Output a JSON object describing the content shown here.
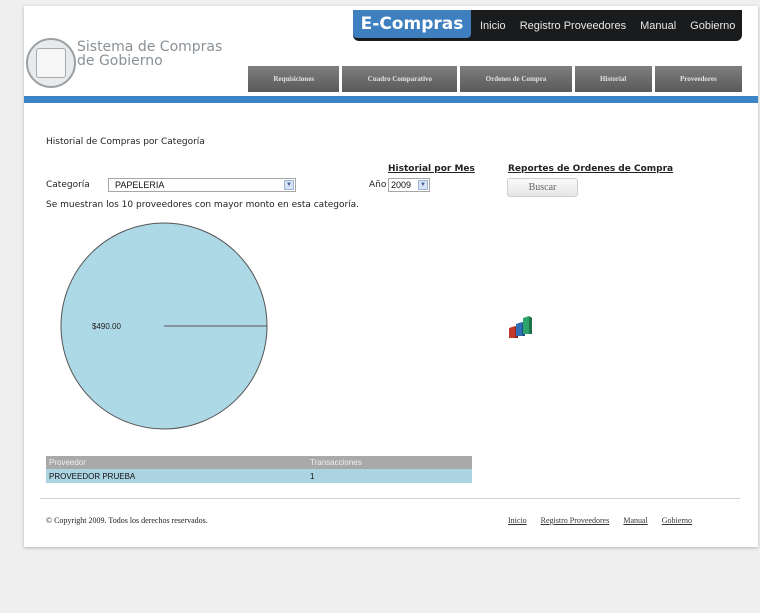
{
  "header": {
    "brand_line1": "Sistema de Compras",
    "brand_line2": "de Gobierno",
    "app_name": "E-Compras",
    "top_links": [
      "Inicio",
      "Registro Proveedores",
      "Manual",
      "Gobierno"
    ],
    "tabs": [
      "Requisiciones",
      "Cuadro Comparativo",
      "Ordenes de Compra",
      "Historial",
      "Proveedores"
    ]
  },
  "main": {
    "section_title": "Historial de Compras por Categoría",
    "historial_link": "Historial por Mes",
    "reportes_link": "Reportes de Ordenes de Compra",
    "categoria_label": "Categoría",
    "categoria_value": "PAPELERIA",
    "anio_label": "Año",
    "anio_value": "2009",
    "buscar_label": "Buscar",
    "note": "Se muestran los 10 proveedores con mayor monto en esta categoría."
  },
  "chart_data": {
    "type": "pie",
    "categories": [
      "PROVEEDOR PRUEBA"
    ],
    "values": [
      490.0
    ],
    "data_labels": [
      "$490.00"
    ],
    "colors": [
      "#add8e6"
    ],
    "title": "",
    "legend": "none"
  },
  "table": {
    "headers": [
      "Proveedor",
      "Transacciones"
    ],
    "rows": [
      [
        "PROVEEDOR PRUEBA",
        "1"
      ]
    ]
  },
  "footer": {
    "copyright": "© Copyright 2009. Todos los derechos reservados.",
    "links": [
      "Inicio",
      "Registro Proveedores",
      "Manual",
      "Gobierno"
    ]
  },
  "colors": {
    "accent_blue": "#3b84c6",
    "topbar": "#1a1b1d",
    "pie_fill": "#add8e6",
    "table_row": "#abd3e2"
  }
}
